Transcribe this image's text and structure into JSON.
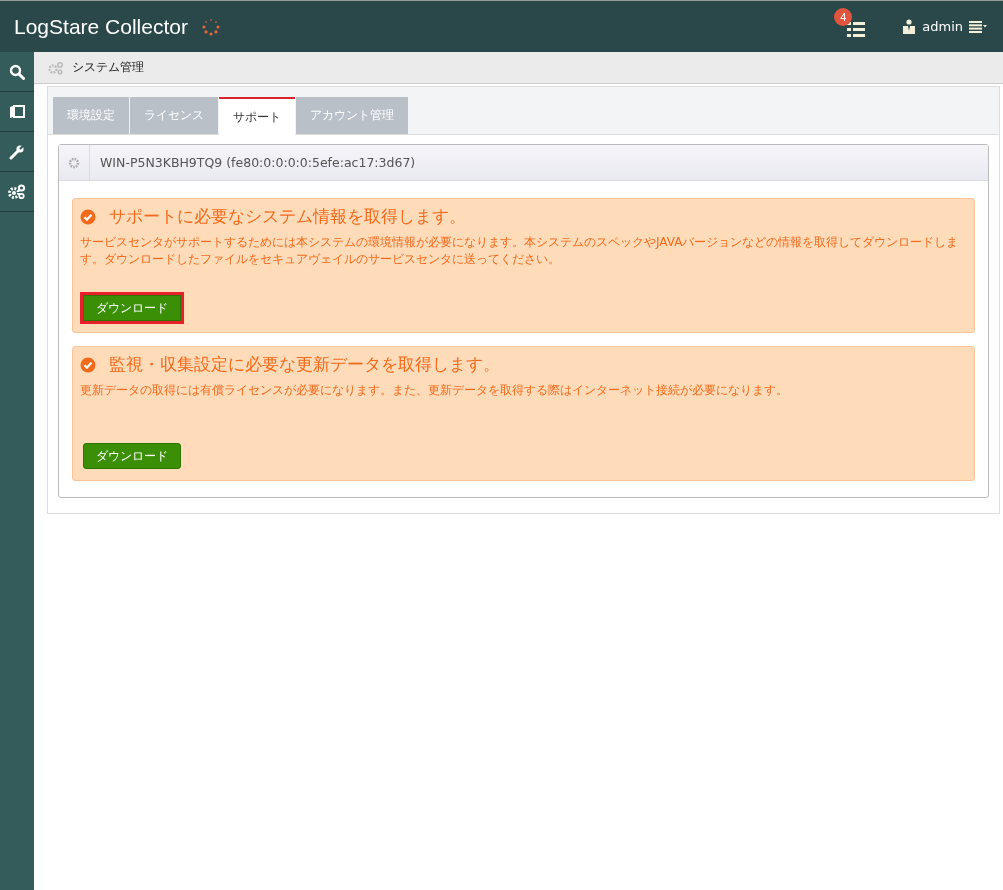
{
  "header": {
    "title": "LogStare Collector",
    "notification_count": "4",
    "user": "admin"
  },
  "sidebar": {
    "items": [
      {
        "kind": "search",
        "selected": false
      },
      {
        "kind": "cards",
        "selected": false
      },
      {
        "kind": "wrench",
        "selected": false
      },
      {
        "kind": "gears",
        "selected": false
      }
    ]
  },
  "breadcrumb": "システム管理",
  "tabs": [
    {
      "label": "環境設定",
      "selected": false
    },
    {
      "label": "ライセンス",
      "selected": false
    },
    {
      "label": "サポート",
      "selected": true
    },
    {
      "label": "アカウント管理",
      "selected": false
    }
  ],
  "panel": {
    "title": "WIN-P5N3KBH9TQ9 (fe80:0:0:0:0:5efe:ac17:3d67)"
  },
  "sections": [
    {
      "heading": "サポートに必要なシステム情報を取得します。",
      "description": "サービスセンタがサポートするためには本システムの環境情報が必要になります。本システムのスペックやJAVAバージョンなどの情報を取得してダウンロードします。ダウンロードしたファイルをセキュアヴェイルのサービスセンタに送ってください。",
      "button": "ダウンロード",
      "highlighted": true
    },
    {
      "heading": "監視・収集設定に必要な更新データを取得します。",
      "description": "更新データの取得には有償ライセンスが必要になります。また、更新データを取得する際はインターネット接続が必要になります。",
      "button": "ダウンロード",
      "highlighted": false
    }
  ]
}
